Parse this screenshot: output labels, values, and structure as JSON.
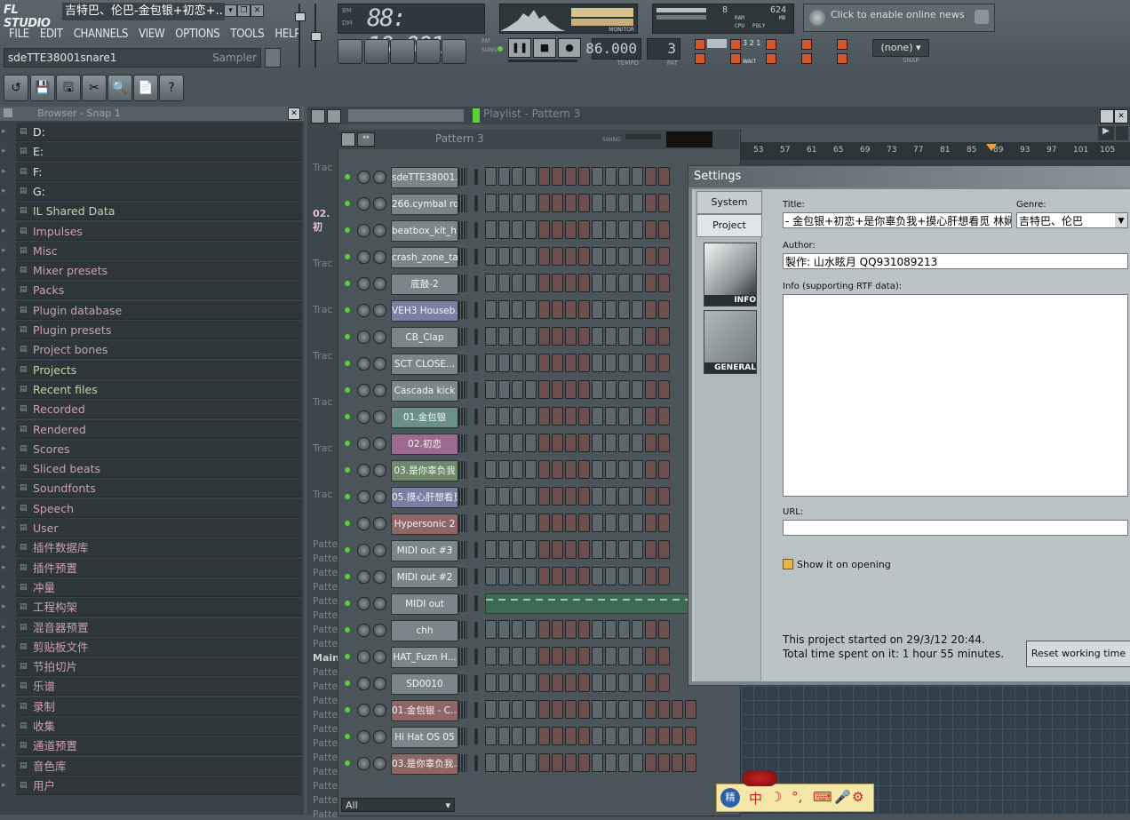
{
  "app": {
    "logo": "FL STUDIO",
    "window_title": "吉特巴、伦巴-金包银+初恋+...",
    "menu": [
      "FILE",
      "EDIT",
      "CHANNELS",
      "VIEW",
      "OPTIONS",
      "TOOLS",
      "HELP"
    ],
    "hint_left": "sdeTTE38001snare1",
    "hint_right": "Sampler",
    "time_display": "88: 10:001",
    "time_mode_top": "BM",
    "time_mode_bottom": "DM",
    "monitor_label": "MONITOR",
    "cpu_value": "8",
    "ram_value": "624",
    "cpu_labels": [
      "RAM",
      "CPU",
      "POLY",
      "MB"
    ],
    "news_text": "Click to enable online news",
    "tempo_value": "86.000",
    "tempo_label": "TEMPO",
    "pattern_value": "3",
    "pattern_label": "PAT",
    "pat_song": [
      "PAT",
      "SONG"
    ],
    "snap_value": "(none)",
    "snap_label": "SNAP",
    "wait_label": "WAIT",
    "counter_321": "3 2 1"
  },
  "browser": {
    "title": "Browser - Snap 1",
    "items": [
      {
        "label": "D:",
        "color": "white"
      },
      {
        "label": "E:",
        "color": "white"
      },
      {
        "label": "F:",
        "color": "white"
      },
      {
        "label": "G:",
        "color": "white"
      },
      {
        "label": "IL Shared Data",
        "color": "green"
      },
      {
        "label": "Impulses",
        "color": "pink"
      },
      {
        "label": "Misc",
        "color": "pink"
      },
      {
        "label": "Mixer presets",
        "color": "pink"
      },
      {
        "label": "Packs",
        "color": "pink"
      },
      {
        "label": "Plugin database",
        "color": "pink"
      },
      {
        "label": "Plugin presets",
        "color": "pink"
      },
      {
        "label": "Project bones",
        "color": "pink"
      },
      {
        "label": "Projects",
        "color": "green"
      },
      {
        "label": "Recent files",
        "color": "green"
      },
      {
        "label": "Recorded",
        "color": "pink"
      },
      {
        "label": "Rendered",
        "color": "pink"
      },
      {
        "label": "Scores",
        "color": "pink"
      },
      {
        "label": "Sliced beats",
        "color": "pink"
      },
      {
        "label": "Soundfonts",
        "color": "pink"
      },
      {
        "label": "Speech",
        "color": "pink"
      },
      {
        "label": "User",
        "color": "pink"
      },
      {
        "label": "插件数据库",
        "color": "pink"
      },
      {
        "label": "插件预置",
        "color": "pink"
      },
      {
        "label": "冲量",
        "color": "pink"
      },
      {
        "label": "工程构架",
        "color": "pink"
      },
      {
        "label": "混音器预置",
        "color": "pink"
      },
      {
        "label": "剪贴板文件",
        "color": "pink"
      },
      {
        "label": "节拍切片",
        "color": "pink"
      },
      {
        "label": "乐谱",
        "color": "pink"
      },
      {
        "label": "录制",
        "color": "pink"
      },
      {
        "label": "收集",
        "color": "pink"
      },
      {
        "label": "通道预置",
        "color": "pink"
      },
      {
        "label": "音色库",
        "color": "pink"
      },
      {
        "label": "用户",
        "color": "pink"
      }
    ]
  },
  "playlist": {
    "title": "Playlist - Pattern 3",
    "ruler": [
      "53",
      "57",
      "61",
      "65",
      "69",
      "73",
      "77",
      "81",
      "85",
      "89",
      "93",
      "97",
      "101",
      "105"
    ],
    "side_labels": [
      "Trac",
      "02.初",
      "Trac",
      "Trac",
      "Trac",
      "Trac",
      "Trac",
      "Trac"
    ],
    "pattern_labels": [
      "Patte",
      "Patte",
      "Patte",
      "Patte",
      "Patte",
      "Patte",
      "Patte",
      "Patte",
      "Main",
      "Patte",
      "Patte",
      "Patte",
      "Patte",
      "Patte",
      "Patte",
      "Patte",
      "Patte",
      "Patte",
      "Patte",
      "Patte"
    ]
  },
  "channel_rack": {
    "pattern": "Pattern 3",
    "swing_label": "SWING",
    "filter": "All",
    "channels": [
      {
        "name": "sdeTTE38001...",
        "color": "#7b868b"
      },
      {
        "name": "266.cymbal roll",
        "color": "#7b868b"
      },
      {
        "name": "beatbox_kit_h...",
        "color": "#7b868b"
      },
      {
        "name": "crash_zone_ta...",
        "color": "#7b868b"
      },
      {
        "name": "底鼓-2",
        "color": "#7b868b"
      },
      {
        "name": "VEH3 Houseb...",
        "color": "#7a7fa3"
      },
      {
        "name": "CB_Clap",
        "color": "#7b868b"
      },
      {
        "name": "SCT CLOSE...",
        "color": "#7b868b"
      },
      {
        "name": "Cascada kick",
        "color": "#7b868b"
      },
      {
        "name": "01.金包银",
        "color": "#6d8f8a"
      },
      {
        "name": "02.初恋",
        "color": "#9c6a8e"
      },
      {
        "name": "03.是你辜负我",
        "color": "#6f8a6a"
      },
      {
        "name": "05.摸心肝想看觅",
        "color": "#7a7fa3"
      },
      {
        "name": "Hypersonic 2",
        "color": "#8f6666"
      },
      {
        "name": "MIDI out #3",
        "color": "#7b868b"
      },
      {
        "name": "MIDI out #2",
        "color": "#7b868b"
      },
      {
        "name": "MIDI out",
        "color": "#7b868b"
      },
      {
        "name": "chh",
        "color": "#7b868b"
      },
      {
        "name": "HAT_Fuzn H...",
        "color": "#7b868b"
      },
      {
        "name": "SD0010",
        "color": "#7b868b"
      },
      {
        "name": "01.金包银 - C...",
        "color": "#8f6666"
      },
      {
        "name": "Hi Hat OS 05",
        "color": "#7b868b"
      },
      {
        "name": "03.是你辜负我...",
        "color": "#8f6666"
      }
    ]
  },
  "settings": {
    "title": "Settings",
    "tabs": [
      "System",
      "Project"
    ],
    "icons": [
      "INFO",
      "GENERAL"
    ],
    "title_label": "Title:",
    "title_value": "- 金包银+初恋+是你辜负我+摸心肝想看觅 林娴",
    "genre_label": "Genre:",
    "genre_value": "吉特巴、伦巴",
    "author_label": "Author:",
    "author_value": "製作: 山水眩月 QQ931089213",
    "info_label": "Info (supporting RTF data):",
    "url_label": "URL:",
    "show_on_open": "Show it on opening",
    "started": "This project started on 29/3/12 20:44.",
    "total_time": "Total time spent on it: 1 hour 55 minutes.",
    "reset_button": "Reset working time"
  },
  "ime": {
    "items": [
      "中",
      "☽",
      "°,",
      "⌨",
      "🎤",
      "⚙"
    ]
  }
}
